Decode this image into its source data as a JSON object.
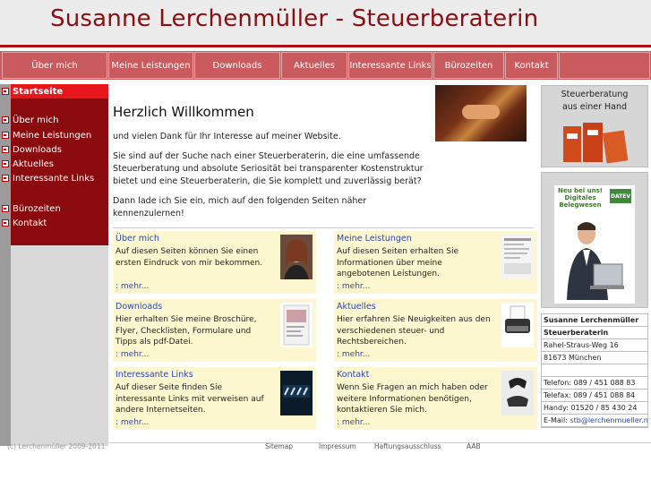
{
  "header": {
    "title": "Susanne Lerchenmüller - Steuerberaterin"
  },
  "topnav": {
    "tabs": [
      {
        "label": "Über mich"
      },
      {
        "label": "Meine Leistungen"
      },
      {
        "label": "Downloads"
      },
      {
        "label": "Aktuelles"
      },
      {
        "label": "Interessante Links"
      },
      {
        "label": "Bürozeiten"
      },
      {
        "label": "Kontakt"
      }
    ]
  },
  "sidebar": {
    "items": [
      {
        "label": "Startseite"
      },
      {
        "label": "Über mich"
      },
      {
        "label": "Meine Leistungen"
      },
      {
        "label": "Downloads"
      },
      {
        "label": "Aktuelles"
      },
      {
        "label": "Interessante Links"
      },
      {
        "label": "Bürozeiten"
      },
      {
        "label": "Kontakt"
      }
    ]
  },
  "main": {
    "welcome": "Herzlich Willkommen",
    "paragraphs": [
      "und vielen Dank für Ihr Interesse auf meiner Website.",
      "Sie sind auf der Suche nach einer Steuerberaterin, die eine umfassende Steuerberatung und absolute Seriosität bei transparenter Kostenstruktur bietet und eine Steuerberaterin, die Sie komplett und zuverlässig berät?",
      "Dann lade ich Sie ein, mich auf den folgenden Seiten näher kennenzulernen!"
    ],
    "boxes": [
      {
        "title": "Über mich",
        "text": "Auf diesen Seiten können Sie einen ersten Eindruck von mir bekommen.",
        "more": ": mehr..."
      },
      {
        "title": "Meine Leistungen",
        "text": "Auf diesen Seiten erhalten Sie Informationen über meine angebotenen Leistungen.",
        "more": ": mehr..."
      },
      {
        "title": "Downloads",
        "text": "Hier erhalten Sie meine Broschüre, Flyer, Checklisten, Formulare und Tipps als pdf-Datei.",
        "more": ": mehr..."
      },
      {
        "title": "Aktuelles",
        "text": "Hier erfahren Sie Neuigkeiten aus den verschiedenen steuer- und Rechtsbereichen.",
        "more": ": mehr..."
      },
      {
        "title": "Interessante Links",
        "text": "Auf dieser Seite finden Sie interessante Links mit verweisen auf andere Internetseiten.",
        "more": ": mehr..."
      },
      {
        "title": "Kontakt",
        "text": "Wenn Sie Fragen an mich haben oder weitere Informationen benötigen, kontaktieren Sie mich.",
        "more": ": mehr..."
      }
    ]
  },
  "right": {
    "tagline1": "Steuerberatung",
    "tagline2": "aus einer Hand",
    "ad_text": "Neu bei uns! Digitales Belegwesen",
    "ad_brand": "DATEV",
    "contact": {
      "name": "Susanne Lerchenmüller",
      "role": "Steuerberaterin",
      "street": "Rahel-Straus-Weg 16",
      "city": "81673 München",
      "phone": "Telefon: 089 / 451 088 83",
      "fax": "Telefax: 089 / 451 088 84",
      "mobile": "Handy: 01520 / 85 430 24",
      "email_label": "E-Mail: ",
      "email": "stb@lerchenmueller.net"
    }
  },
  "footer": {
    "copyright": "(c) Lerchenmüller 2009-2011",
    "links": [
      "Sitemap",
      "Impressum",
      "Haftungsausschluss",
      "AAB"
    ]
  },
  "colors": {
    "header_title": "#8b0d10",
    "nav_bg": "#c95b5f",
    "sidebar_bg": "#8a0a0d",
    "sidebar_active": "#e8151b",
    "box_bg": "#fdf7d0",
    "link": "#2a46b8"
  }
}
